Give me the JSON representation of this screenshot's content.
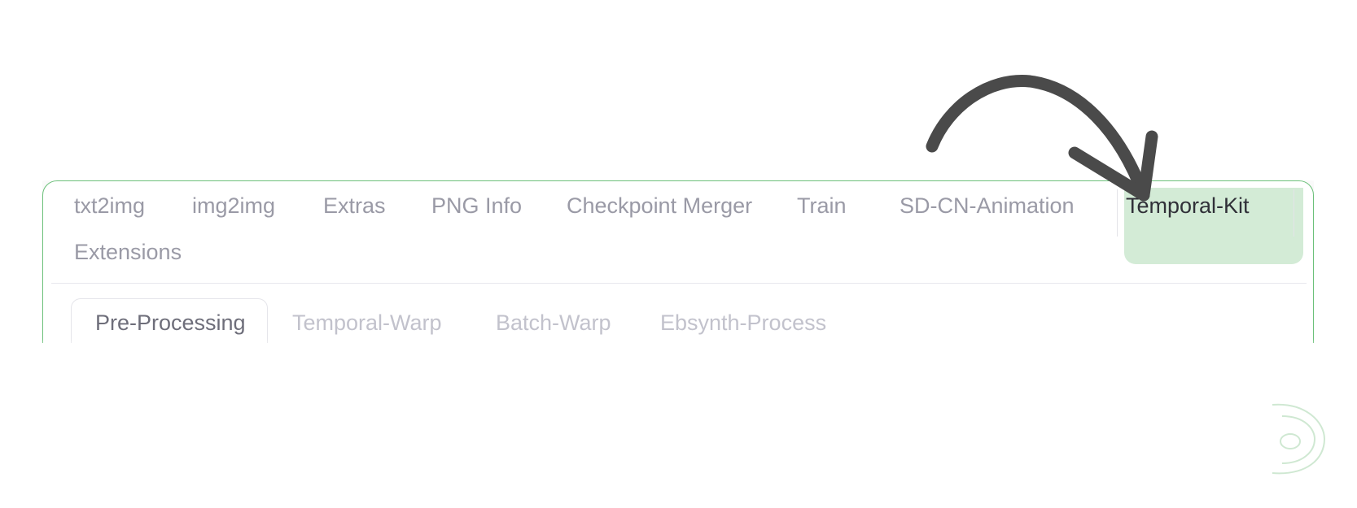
{
  "main_tabs": {
    "items": [
      {
        "label": "txt2img"
      },
      {
        "label": "img2img"
      },
      {
        "label": "Extras"
      },
      {
        "label": "PNG Info"
      },
      {
        "label": "Checkpoint Merger"
      },
      {
        "label": "Train"
      },
      {
        "label": "SD-CN-Animation"
      },
      {
        "label": "Temporal-Kit"
      },
      {
        "label": "Extensions"
      }
    ],
    "active": "Temporal-Kit",
    "active_color": "#d3ebd6"
  },
  "sub_tabs": {
    "items": [
      {
        "label": "Pre-Processing"
      },
      {
        "label": "Temporal-Warp"
      },
      {
        "label": "Batch-Warp"
      },
      {
        "label": "Ebsynth-Process"
      }
    ],
    "active": "Pre-Processing"
  },
  "colors": {
    "panel_border": "#6cc07a",
    "highlight": "#d3ebd6",
    "arrow": "#4a4a4a",
    "logo": "#cfe8d2"
  },
  "icons": {
    "arrow": "curved-arrow-icon",
    "logo": "brand-logo-icon"
  }
}
